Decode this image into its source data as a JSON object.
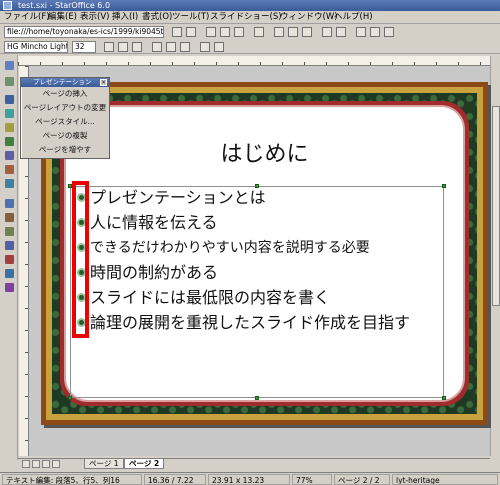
{
  "window": {
    "title": "test.sxi - StarOffice 6.0"
  },
  "menu": [
    "ファイル(F)",
    "編集(E)",
    "表示(V)",
    "挿入(I)",
    "書式(O)",
    "ツール(T)",
    "スライドショー(S)",
    "ウィンドウ(W)",
    "ヘルプ(H)"
  ],
  "url": {
    "value": "file:///home/toyonaka/es-ics/1999/ki9045tt/test"
  },
  "font": {
    "name": "HG Mincho Light",
    "size": "32"
  },
  "panel": {
    "title": "プレゼンテーション",
    "items": [
      "ページの挿入",
      "ページレイアウトの変更",
      "ページスタイル...",
      "ページの複製",
      "ページを増やす"
    ]
  },
  "slide": {
    "title": "はじめに",
    "bullets": [
      "プレゼンテーションとは",
      "人に情報を伝える",
      "できるだけわかりやすい内容を説明する必要",
      "時間の制約がある",
      "スライドには最低限の内容を書く",
      "論理の展開を重視したスライド作成を目指す"
    ]
  },
  "tabs": [
    "ページ 1",
    "ページ 2"
  ],
  "status": {
    "mode": "テキスト編集: 段落5、行5、列16",
    "position": "16.36 / 7.22",
    "size": "23.91 x 13.23",
    "zoom": "77%",
    "page": "ページ 2 / 2",
    "style": "lyt-heritage"
  },
  "colors": {
    "frame_brown": "#8b4a16",
    "frame_gold": "#c8a23c",
    "frame_green": "#1f3a22",
    "frame_red": "#a02c2c",
    "highlight": "#ee0000"
  }
}
